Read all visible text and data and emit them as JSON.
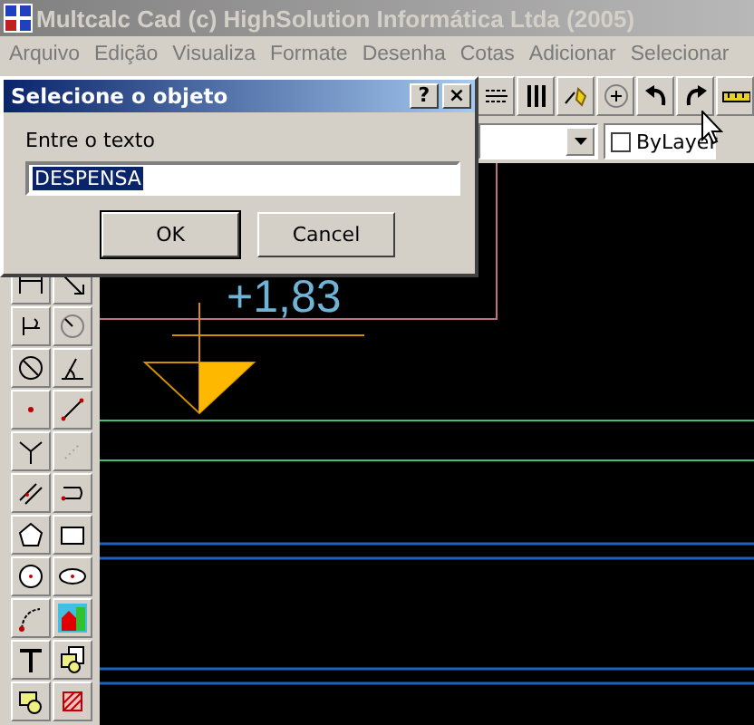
{
  "window": {
    "title": "Multcalc Cad (c) HighSolution Informática Ltda (2005)"
  },
  "menu": [
    {
      "label": "Arquivo",
      "disabled": true
    },
    {
      "label": "Edição",
      "disabled": true
    },
    {
      "label": "Visualiza",
      "disabled": true
    },
    {
      "label": "Formate",
      "disabled": true
    },
    {
      "label": "Desenha",
      "disabled": true
    },
    {
      "label": "Cotas",
      "disabled": true
    },
    {
      "label": "Adicionar",
      "disabled": true
    },
    {
      "label": "Selecionar",
      "disabled": true
    }
  ],
  "layer_field": {
    "label": "ByLayer",
    "checked": false
  },
  "drawing": {
    "elevation_label": "+1,83"
  },
  "dialog": {
    "title": "Selecione o objeto",
    "help": "?",
    "close": "×",
    "prompt": "Entre o texto",
    "value": "DESPENSA",
    "value_selected": true,
    "buttons": [
      {
        "label": "OK",
        "default": true
      },
      {
        "label": "Cancel",
        "default": false
      }
    ]
  }
}
